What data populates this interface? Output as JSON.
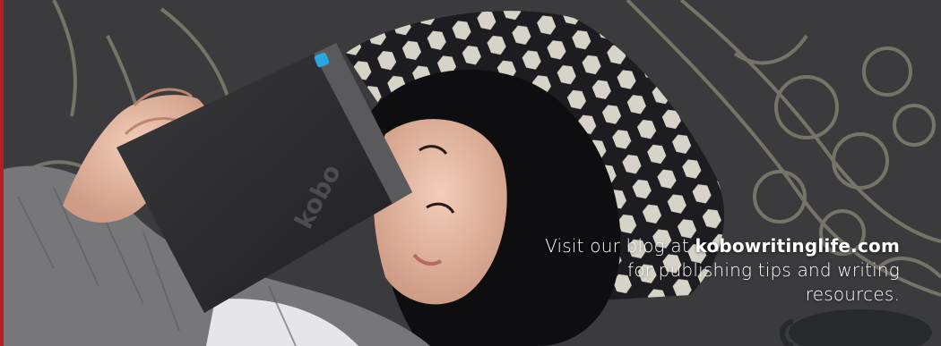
{
  "banner": {
    "caption": {
      "prefix": "Visit our blog at ",
      "link": "kobowritinglife.com",
      "line2": "for publishing tips and writing",
      "line3": "resources."
    },
    "device_logo": "kobo",
    "colors": {
      "accent": "#b51f24",
      "device_button": "#29a8e0",
      "rug": "#3b3b3d"
    }
  }
}
